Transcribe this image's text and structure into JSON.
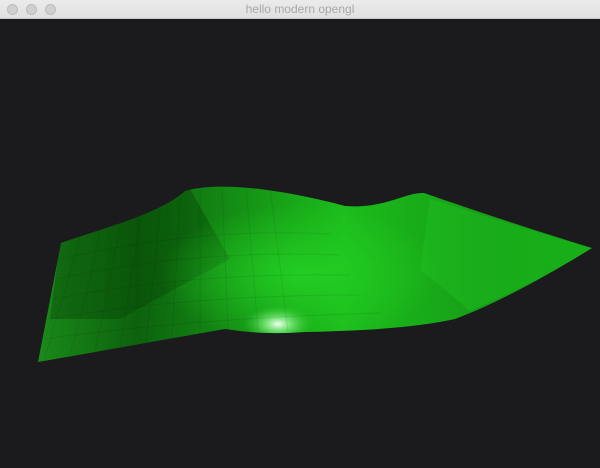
{
  "window": {
    "title": "hello modern opengl"
  },
  "titlebar": {
    "buttons": [
      {
        "name": "close",
        "state": "inactive"
      },
      {
        "name": "minimize",
        "state": "inactive"
      },
      {
        "name": "zoom",
        "state": "inactive"
      }
    ]
  },
  "scene": {
    "background_color": "#1b1a1c",
    "surface_color": "#1fbf1f",
    "surface_shadow_color": "#0a5a0a",
    "highlight_color": "#e6ffe6",
    "object": "wavy-mesh-surface"
  }
}
